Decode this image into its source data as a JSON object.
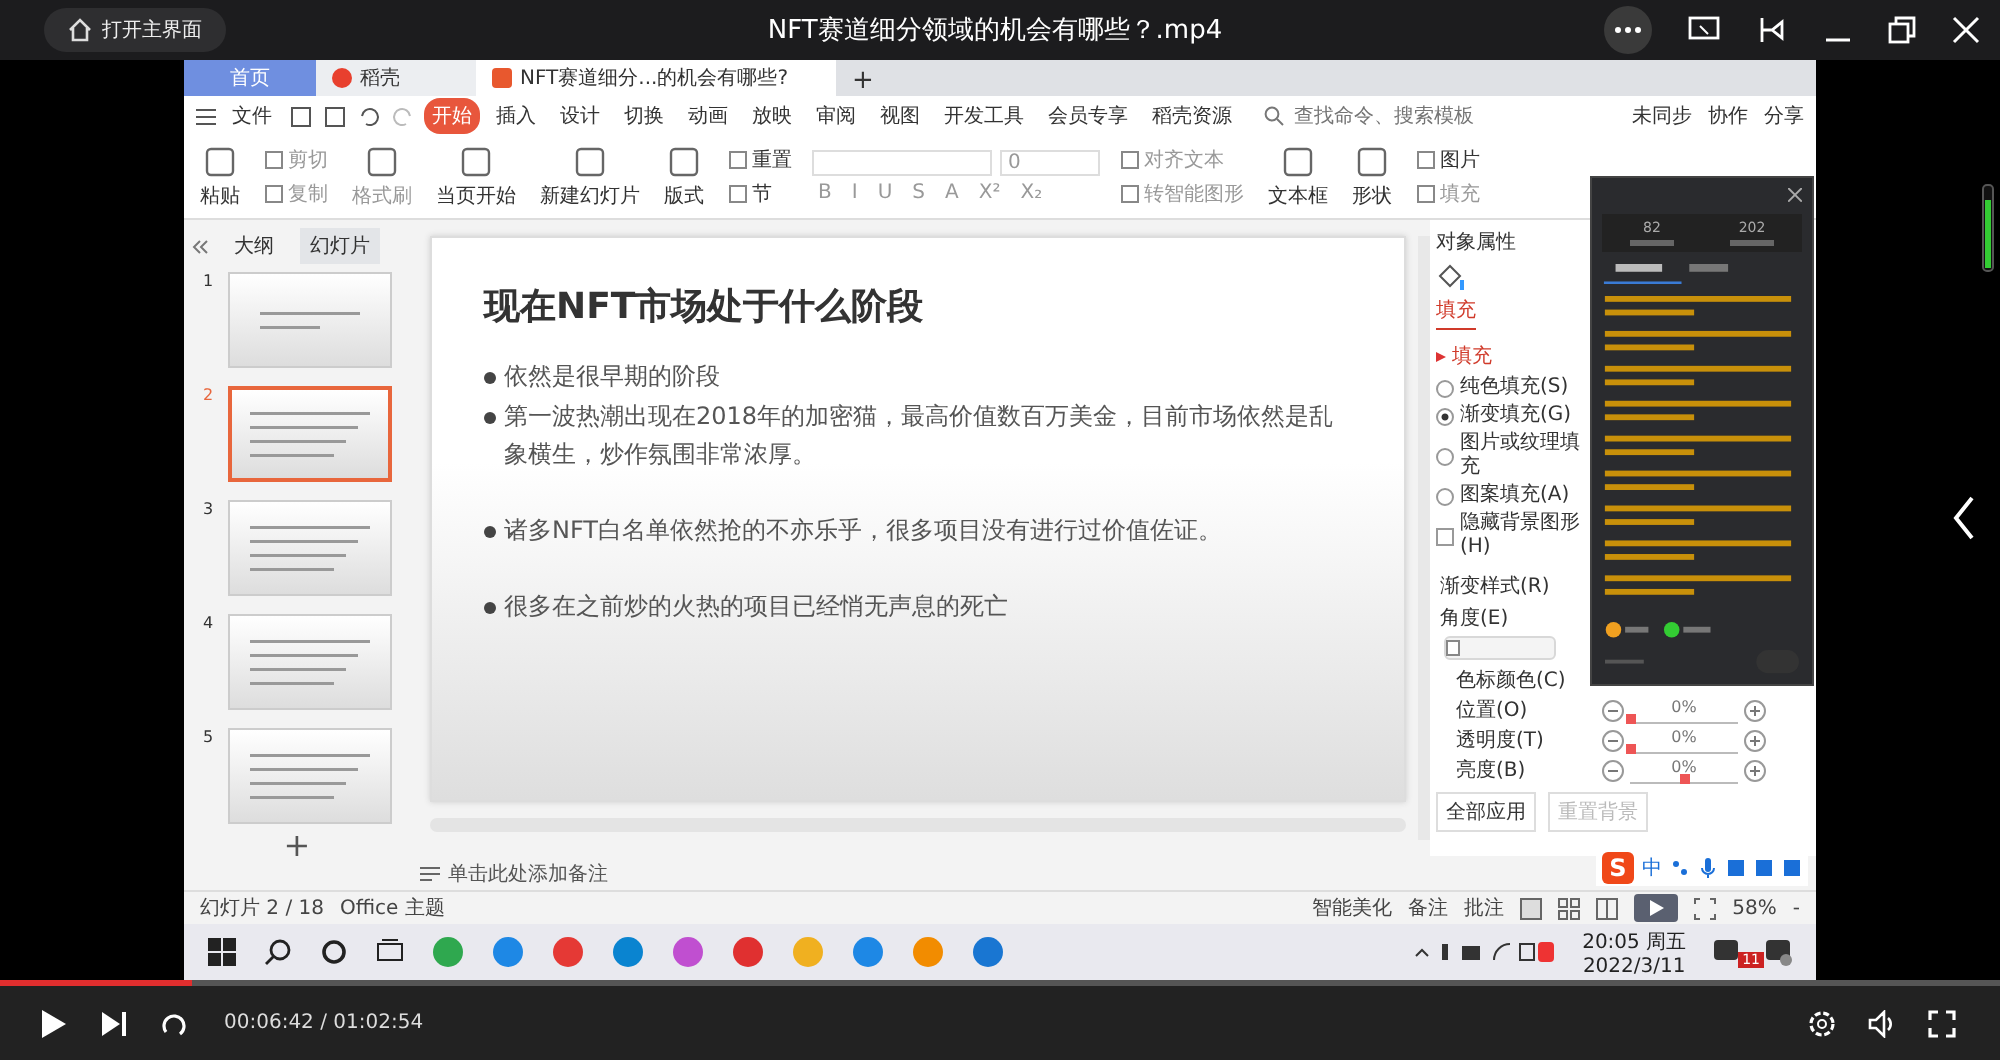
{
  "player": {
    "home_button": "打开主界面",
    "title": "NFT赛道细分领域的机会有哪些？.mp4",
    "time": "00:06:42 / 01:02:54",
    "progress": {
      "level": 0.096
    }
  },
  "wps": {
    "tabs": [
      {
        "label": "首页",
        "kind": "home",
        "selected": false
      },
      {
        "label": "稻壳",
        "kind": "docer",
        "selected": false
      },
      {
        "label": "NFT赛道细分...的机会有哪些?",
        "kind": "doc",
        "selected": true
      }
    ],
    "add_tab": "+",
    "file_menu": "文件",
    "menu": [
      {
        "label": "开始",
        "selected": true
      },
      {
        "label": "插入",
        "selected": false
      },
      {
        "label": "设计",
        "selected": false
      },
      {
        "label": "切换",
        "selected": false
      },
      {
        "label": "动画",
        "selected": false
      },
      {
        "label": "放映",
        "selected": false
      },
      {
        "label": "审阅",
        "selected": false
      },
      {
        "label": "视图",
        "selected": false
      },
      {
        "label": "开发工具",
        "selected": false
      },
      {
        "label": "会员专享",
        "selected": false
      },
      {
        "label": "稻壳资源",
        "selected": false
      }
    ],
    "search": {
      "placeholder": "查找命令、搜索模板"
    },
    "menu_right": [
      "未同步",
      "协作",
      "分享"
    ],
    "ribbon": [
      [
        {
          "label": "粘贴"
        }
      ],
      [
        {
          "label": "剪切",
          "disabled": true
        },
        {
          "label": "复制",
          "disabled": true
        }
      ],
      [
        {
          "label": "格式刷",
          "disabled": true
        }
      ],
      [
        {
          "label": "当页开始"
        }
      ],
      [
        {
          "label": "新建幻灯片"
        }
      ],
      [
        {
          "label": "版式"
        }
      ],
      [
        {
          "label": "重置"
        },
        {
          "label": "节"
        }
      ],
      [
        {
          "label": "对齐文本",
          "disabled": true
        },
        {
          "label": "转智能图形",
          "disabled": true
        }
      ],
      [
        {
          "label": "文本框"
        }
      ],
      [
        {
          "label": "形状"
        }
      ],
      [
        {
          "label": "图片"
        },
        {
          "label": "填充",
          "disabled": true
        }
      ]
    ],
    "font": {
      "size": "0",
      "styles": [
        "B",
        "I",
        "U",
        "S",
        "A",
        "X²",
        "X₂"
      ]
    },
    "outline_tabs": [
      {
        "label": "大纲",
        "selected": false
      },
      {
        "label": "幻灯片",
        "selected": true
      }
    ],
    "thumbnails": [
      {
        "number": "1",
        "selected": false
      },
      {
        "number": "2",
        "selected": true
      },
      {
        "number": "3",
        "selected": false
      },
      {
        "number": "4",
        "selected": false
      },
      {
        "number": "5",
        "selected": false
      }
    ],
    "add_slide": "+",
    "slide": {
      "title": "现在NFT市场处于什么阶段",
      "bullets": [
        "依然是很早期的阶段",
        "第一波热潮出现在2018年的加密猫，最高价值数百万美金，目前市场依然是乱象横生，炒作氛围非常浓厚。",
        "诸多NFT白名单依然抢的不亦乐乎，很多项目没有进行过价值佐证。",
        "很多在之前炒的火热的项目已经悄无声息的死亡"
      ]
    },
    "notes_placeholder": "单击此处添加备注",
    "properties": {
      "title": "对象属性",
      "tab": "填充",
      "section": "填充",
      "options": [
        {
          "kind": "radio",
          "label": "纯色填充(S)",
          "checked": false
        },
        {
          "kind": "radio",
          "label": "渐变填充(G)",
          "checked": true
        },
        {
          "kind": "radio",
          "label": "图片或纹理填充",
          "checked": false
        },
        {
          "kind": "radio",
          "label": "图案填充(A)",
          "checked": false
        },
        {
          "kind": "checkbox",
          "label": "隐藏背景图形(H)",
          "checked": false
        }
      ],
      "gradient_style": "渐变样式(R)",
      "angle": {
        "label": "角度(E)",
        "level": 0
      },
      "color_stop": "色标颜色(C)",
      "sliders": [
        {
          "label": "位置(O)",
          "reading": "0%",
          "level": 0
        },
        {
          "label": "透明度(T)",
          "reading": "0%",
          "level": 0
        },
        {
          "label": "亮度(B)",
          "reading": "0%",
          "level": 0.5
        }
      ],
      "buttons": [
        "全部应用",
        "重置背景"
      ]
    },
    "status": {
      "slide_count": "幻灯片 2 / 18",
      "theme": "Office 主题",
      "beautify": "智能美化",
      "notes": "备注",
      "comments": "批注",
      "zoom": "58%",
      "minus": "-"
    },
    "ime": {
      "logo": "S",
      "mode": "中"
    },
    "chat": {
      "stats": [
        "82",
        "202"
      ]
    }
  },
  "taskbar": {
    "time": "20:05 周五",
    "date": "2022/3/11",
    "badge": "11"
  }
}
